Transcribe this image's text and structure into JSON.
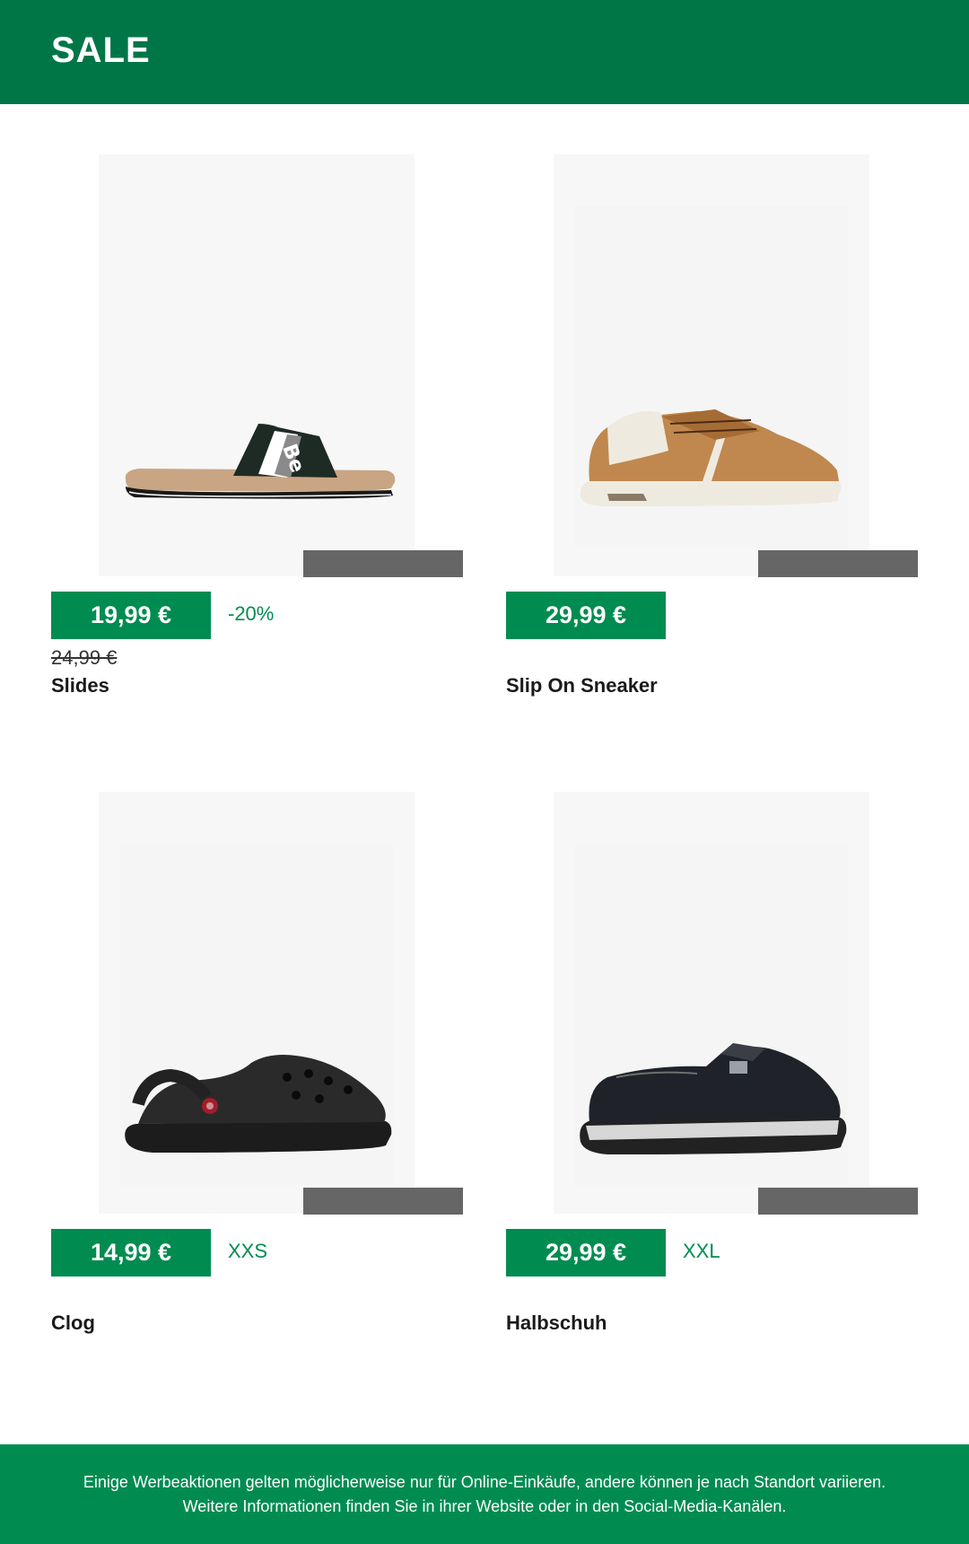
{
  "header": {
    "title": "SALE"
  },
  "products": [
    {
      "name": "Slides",
      "price": "19,99 €",
      "side_label": "-20%",
      "old_price": "24,99 €",
      "icon": "slide-sandal-image"
    },
    {
      "name": "Slip On Sneaker",
      "price": "29,99 €",
      "side_label": "",
      "old_price": "",
      "icon": "sneaker-image"
    },
    {
      "name": "Clog",
      "price": "14,99 €",
      "side_label": "XXS",
      "old_price": "",
      "icon": "clog-image"
    },
    {
      "name": "Halbschuh",
      "price": "29,99 €",
      "side_label": "XXL",
      "old_price": "",
      "icon": "halbschuh-image"
    }
  ],
  "footer": {
    "text": "Einige Werbeaktionen gelten möglicherweise nur für Online-Einkäufe, andere können je nach Standort variieren. Weitere Informationen finden Sie in ihrer Website oder in den Social-Media-Kanälen."
  },
  "colors": {
    "header_bg": "#007647",
    "price_bg": "#008c51",
    "footer_bg": "#008c51",
    "tag_grey": "#666666"
  }
}
